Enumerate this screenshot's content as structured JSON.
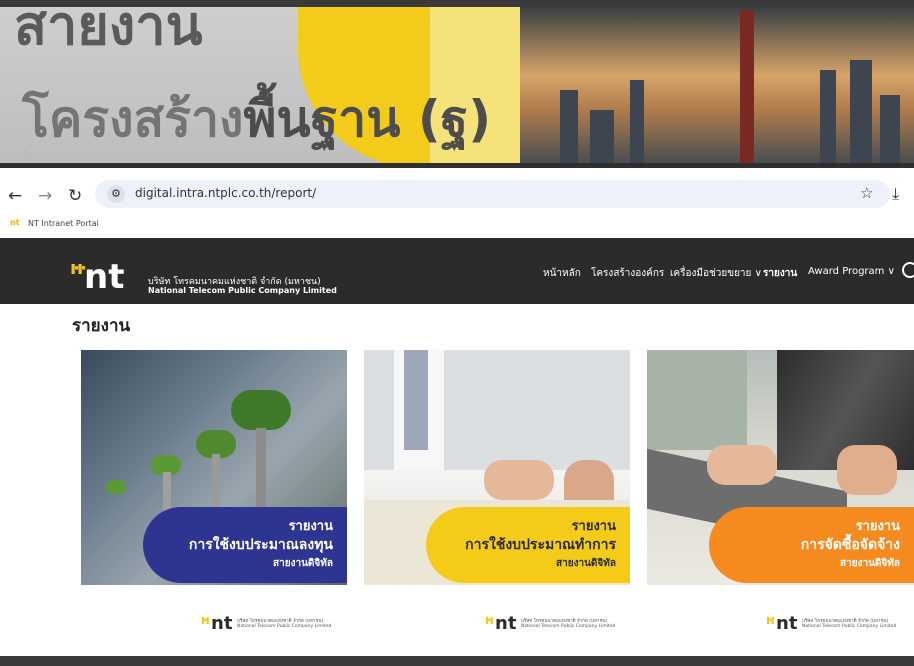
{
  "hero": {
    "line1": "สายงาน",
    "line2a": "โครงสร้าง",
    "line2b": "พื้นฐาน (ฐ)"
  },
  "browser": {
    "back_icon": "arrow-left-icon",
    "forward_icon": "arrow-right-icon",
    "reload_icon": "reload-icon",
    "url": "digital.intra.ntplc.co.th/report/",
    "bookmark_label": "NT Intranet Portal"
  },
  "header": {
    "company_th": "บริษัท โทรคมนาคมแห่งชาติ จำกัด (มหาชน)",
    "company_en": "National Telecom Public Company Limited",
    "menu": [
      {
        "label": "หน้าหลัก"
      },
      {
        "label": "โครงสร้างองค์กร"
      },
      {
        "label": "เครื่องมือช่วยขยาย ∨"
      },
      {
        "label": "รายงาน"
      },
      {
        "label": "Award Program ∨"
      }
    ]
  },
  "page": {
    "title": "รายงาน",
    "cards": [
      {
        "line1": "รายงาน",
        "line2": "การใช้งบประมาณลงทุน",
        "line3": "สายงานดิจิทัล",
        "accent": "#2d3590"
      },
      {
        "line1": "รายงาน",
        "line2": "การใช้งบประมาณทำการ",
        "line3": "สายงานดิจิทัล",
        "accent": "#f5cb1a"
      },
      {
        "line1": "รายงาน",
        "line2": "การจัดซื้อจัดจ้าง",
        "line3": "สายงานดิจิทัล",
        "accent": "#f58a1f"
      }
    ],
    "footer_logo": {
      "mark": "nt",
      "th": "บริษัท โทรคมนาคมแห่งชาติ จำกัด (มหาชน)",
      "en": "National Telecom Public Company Limited"
    }
  },
  "colors": {
    "header_bg": "#2b2b2b",
    "brand_yellow": "#f7c615"
  }
}
